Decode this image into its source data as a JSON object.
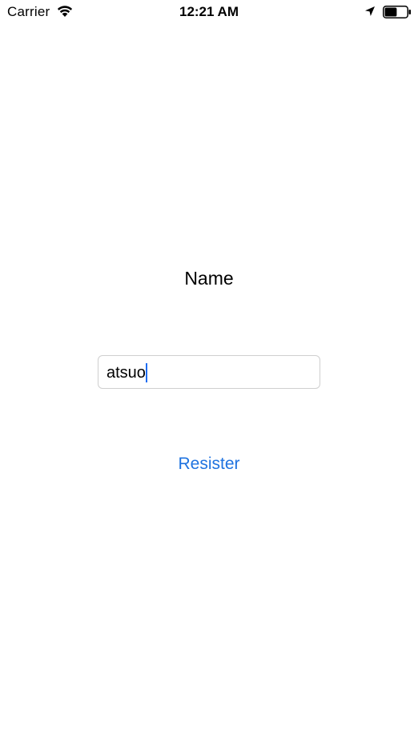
{
  "status_bar": {
    "carrier": "Carrier",
    "time": "12:21 AM",
    "icons": [
      "wifi-icon",
      "location-arrow-icon",
      "battery-icon"
    ],
    "battery_level": 0.55
  },
  "form": {
    "name_label": "Name",
    "name_value": "atsuo",
    "register_label": "Resister"
  },
  "colors": {
    "accent": "#1f73e0",
    "field_border": "#cfcfcf",
    "caret": "#1f6df2"
  }
}
